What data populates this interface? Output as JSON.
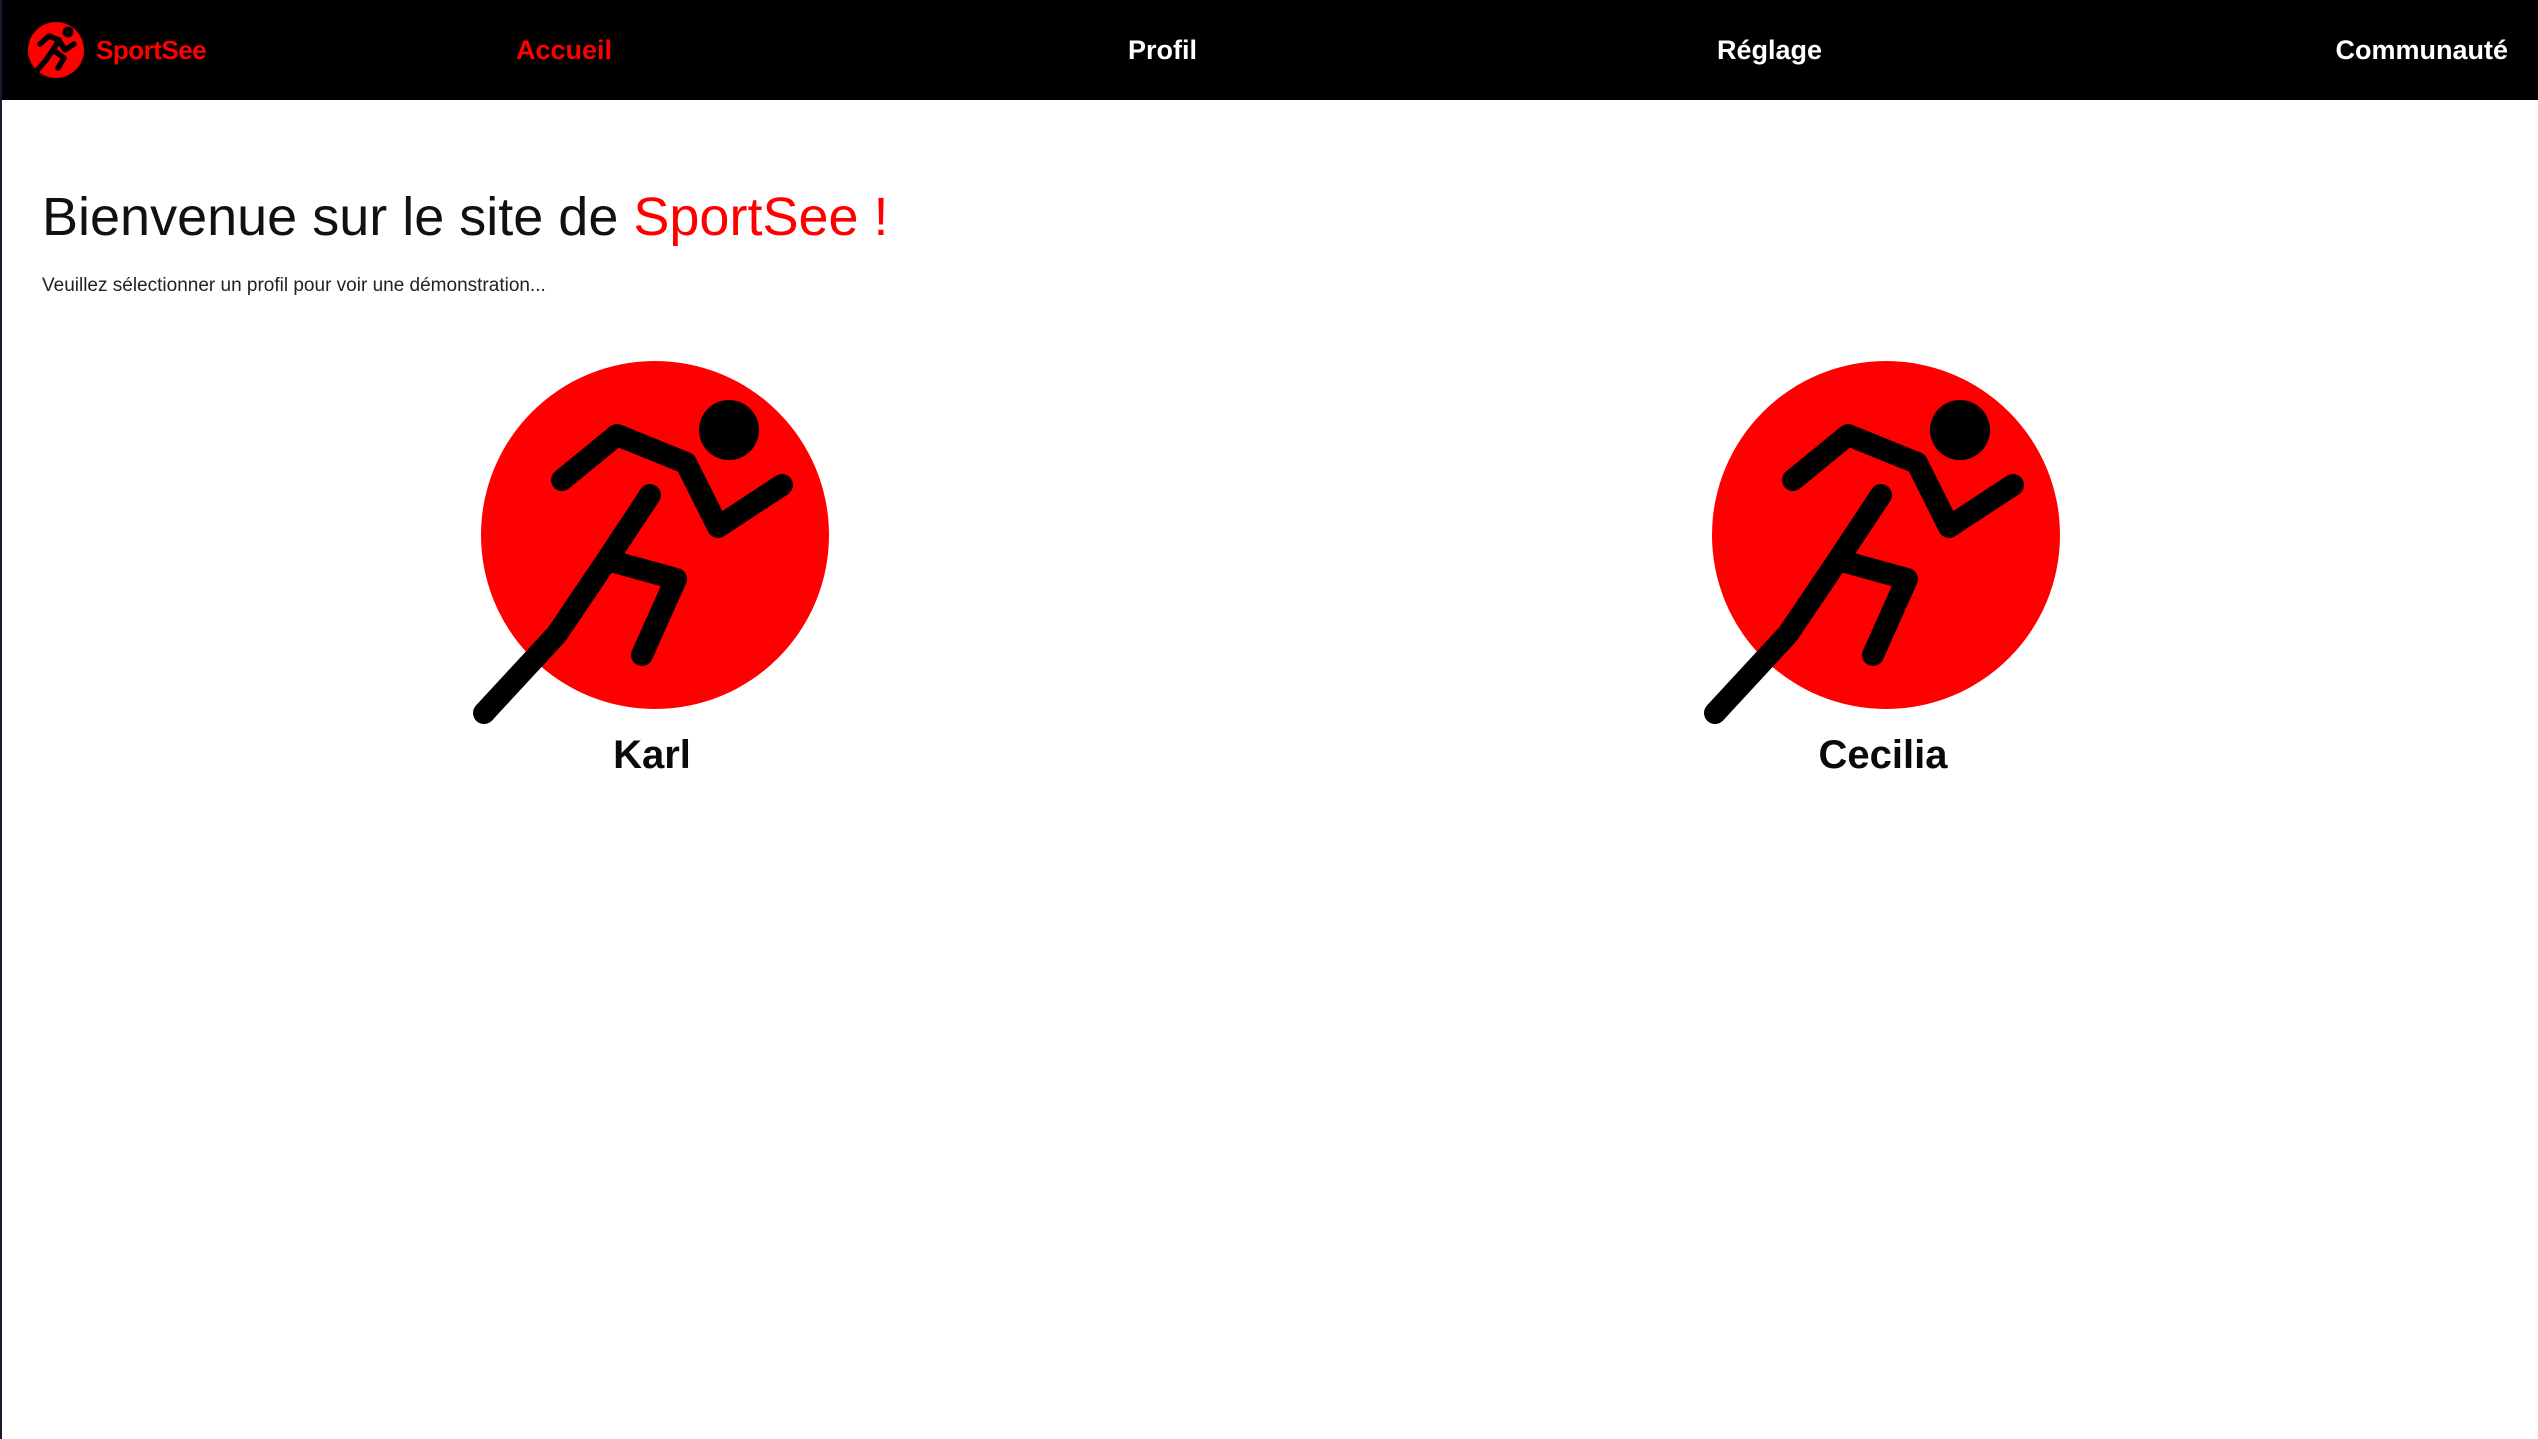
{
  "brand": {
    "name": "SportSee",
    "logo_icon": "runner-logo-icon",
    "accent_color": "#ff0000"
  },
  "nav": {
    "items": [
      {
        "label": "Accueil",
        "active": true
      },
      {
        "label": "Profil",
        "active": false
      },
      {
        "label": "Réglage",
        "active": false
      },
      {
        "label": "Communauté",
        "active": false
      }
    ],
    "text_color": "#ffffff",
    "active_color": "#ff0000",
    "background": "#000000"
  },
  "welcome": {
    "title_prefix": "Bienvenue sur le site de ",
    "title_highlight": "SportSee !",
    "subtitle": "Veuillez sélectionner un profil pour voir une démonstration..."
  },
  "profiles": [
    {
      "name": "Karl",
      "icon": "runner-avatar-icon"
    },
    {
      "name": "Cecilia",
      "icon": "runner-avatar-icon"
    }
  ]
}
